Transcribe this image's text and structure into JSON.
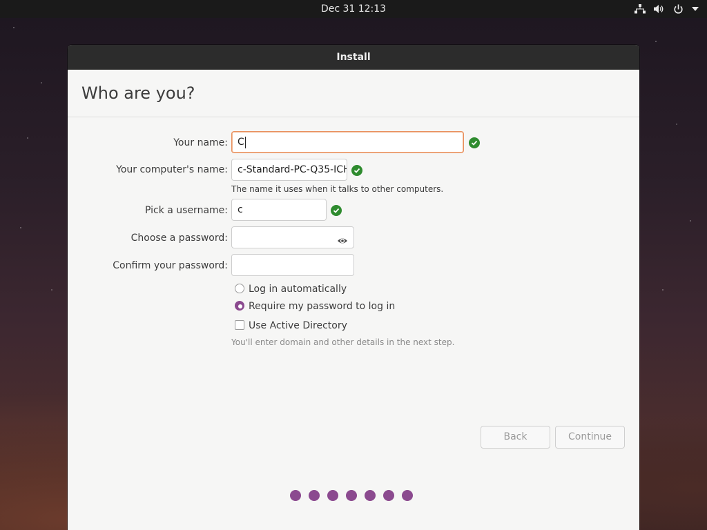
{
  "topbar": {
    "clock": "Dec 31  12:13"
  },
  "window": {
    "title": "Install",
    "heading": "Who are you?"
  },
  "form": {
    "your_name_label": "Your name:",
    "your_name_value": "C",
    "computer_name_label": "Your computer's name:",
    "computer_name_value": "c-Standard-PC-Q35-ICH",
    "computer_name_hint": "The name it uses when it talks to other computers.",
    "username_label": "Pick a username:",
    "username_value": "c",
    "password_label": "Choose a password:",
    "password_value": "",
    "confirm_label": "Confirm your password:",
    "confirm_value": "",
    "login_auto_label": "Log in automatically",
    "login_require_label": "Require my password to log in",
    "login_selected": "require",
    "active_directory_label": "Use Active Directory",
    "active_directory_checked": false,
    "active_directory_hint": "You'll enter domain and other details in the next step."
  },
  "buttons": {
    "back": "Back",
    "continue": "Continue"
  },
  "progress": {
    "steps": 7,
    "accent": "#8b4a8f"
  },
  "colors": {
    "valid": "#2e8b2e",
    "focus": "#e9905e"
  }
}
